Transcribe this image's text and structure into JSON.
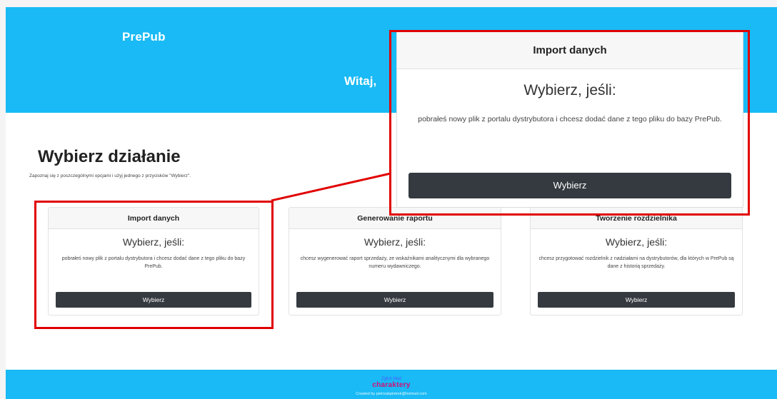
{
  "header": {
    "brand": "PrePub",
    "welcome": "Witaj,"
  },
  "section": {
    "title": "Wybierz działanie",
    "subtitle": "Zapoznaj się z poszczególnymi opcjami i użyj jednego z przycisków \"Wybierz\"."
  },
  "cards": [
    {
      "title": "Import danych",
      "lead": "Wybierz, jeśli:",
      "text": "pobrałeś nowy plik z portalu dystrybutora i chcesz dodać dane z tego pliku do bazy PrePub.",
      "button": "Wybierz"
    },
    {
      "title": "Generowanie raportu",
      "lead": "Wybierz, jeśli:",
      "text": "chcesz wygenerować raport sprzedaży, ze wskaźnikami analitycznymi dla wybranego numeru wydawniczego.",
      "button": "Wybierz"
    },
    {
      "title": "Tworzenie rozdzielnika",
      "lead": "Wybierz, jeśli:",
      "text": "chcesz przygotować rozdzielnik z nadziałami na dystrybutorów, dla których w PrePub są dane z historią sprzedaży.",
      "button": "Wybierz"
    }
  ],
  "zoom": {
    "title": "Import danych",
    "lead": "Wybierz, jeśli:",
    "text": "pobrałeś nowy plik z portalu dystrybutora i chcesz dodać dane z tego pliku do bazy PrePub.",
    "button": "Wybierz"
  },
  "footer": {
    "link": "Zgłoś błąd",
    "logo": "charaktery",
    "credit": "Created by pietrzakpiotrek@hotmail.com"
  },
  "colors": {
    "header_bg": "#19baf5",
    "button_bg": "#343a40",
    "highlight": "#e10000",
    "logo": "#d01078"
  }
}
